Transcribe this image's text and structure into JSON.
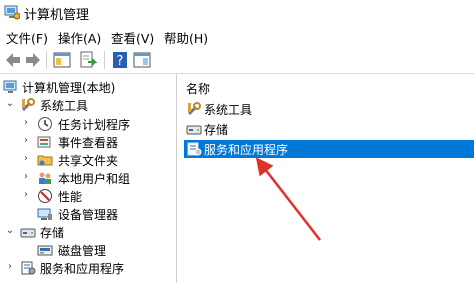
{
  "window": {
    "title": "计算机管理"
  },
  "menu": [
    "文件(F)",
    "操作(A)",
    "查看(V)",
    "帮助(H)"
  ],
  "tree": [
    {
      "label": "计算机管理(本地)",
      "expander": "",
      "icon": "computer-management-icon"
    },
    {
      "label": "系统工具",
      "expander": "⌄",
      "icon": "system-tools-icon"
    },
    {
      "label": "任务计划程序",
      "expander": "›",
      "icon": "task-scheduler-icon"
    },
    {
      "label": "事件查看器",
      "expander": "›",
      "icon": "event-viewer-icon"
    },
    {
      "label": "共享文件夹",
      "expander": "›",
      "icon": "shared-folders-icon"
    },
    {
      "label": "本地用户和组",
      "expander": "›",
      "icon": "local-users-icon"
    },
    {
      "label": "性能",
      "expander": "›",
      "icon": "performance-icon"
    },
    {
      "label": "设备管理器",
      "expander": "",
      "icon": "device-manager-icon"
    },
    {
      "label": "存储",
      "expander": "⌄",
      "icon": "storage-icon"
    },
    {
      "label": "磁盘管理",
      "expander": "",
      "icon": "disk-management-icon"
    },
    {
      "label": "服务和应用程序",
      "expander": "›",
      "icon": "services-apps-icon"
    }
  ],
  "list": {
    "column_header": "名称",
    "items": [
      {
        "label": "系统工具",
        "icon": "system-tools-icon",
        "selected": false
      },
      {
        "label": "存储",
        "icon": "storage-icon",
        "selected": false
      },
      {
        "label": "服务和应用程序",
        "icon": "services-apps-icon",
        "selected": true
      }
    ]
  },
  "colors": {
    "selection": "#0078d7",
    "annotation_arrow": "#e0312a"
  }
}
